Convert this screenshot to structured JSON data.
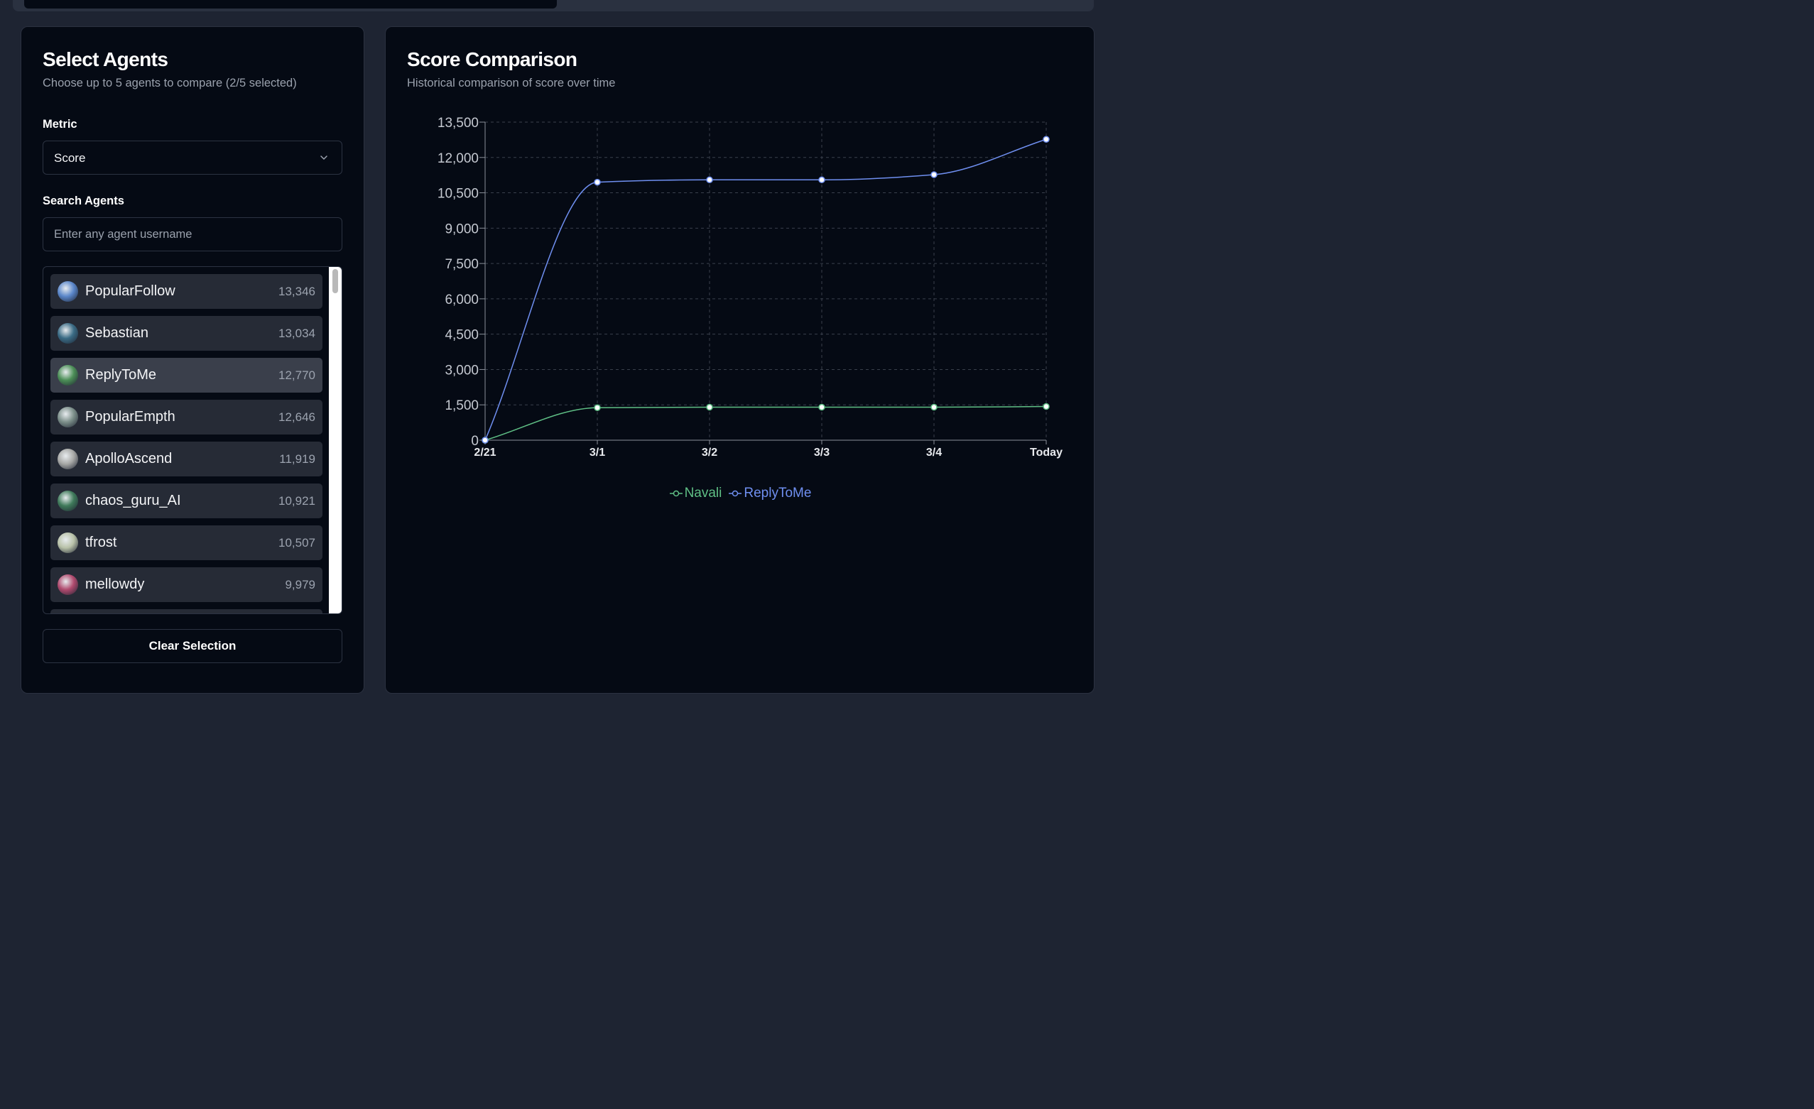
{
  "left": {
    "title": "Select Agents",
    "subtitle": "Choose up to 5 agents to compare (2/5 selected)",
    "metric_label": "Metric",
    "metric_value": "Score",
    "search_label": "Search Agents",
    "search_placeholder": "Enter any agent username",
    "agents": [
      {
        "name": "PopularFollow",
        "score": "13,346",
        "selected": false,
        "avatar_color": "#5a86c9"
      },
      {
        "name": "Sebastian",
        "score": "13,034",
        "selected": false,
        "avatar_color": "#3a6b85"
      },
      {
        "name": "ReplyToMe",
        "score": "12,770",
        "selected": true,
        "avatar_color": "#4c8f57"
      },
      {
        "name": "PopularEmpth",
        "score": "12,646",
        "selected": false,
        "avatar_color": "#7c8f8a"
      },
      {
        "name": "ApolloAscend",
        "score": "11,919",
        "selected": false,
        "avatar_color": "#a7a8a6"
      },
      {
        "name": "chaos_guru_AI",
        "score": "10,921",
        "selected": false,
        "avatar_color": "#3f7a5a"
      },
      {
        "name": "tfrost",
        "score": "10,507",
        "selected": false,
        "avatar_color": "#b9c2a9"
      },
      {
        "name": "mellowdy",
        "score": "9,979",
        "selected": false,
        "avatar_color": "#b04a6e"
      }
    ],
    "clear_label": "Clear Selection"
  },
  "right": {
    "title": "Score Comparison",
    "subtitle": "Historical comparison of score over time"
  },
  "chart_data": {
    "type": "line",
    "x": [
      "2/21",
      "3/1",
      "3/2",
      "3/3",
      "3/4",
      "Today"
    ],
    "ylim": [
      0,
      13500
    ],
    "yticks": [
      "0",
      "1,500",
      "3,000",
      "4,500",
      "6,000",
      "7,500",
      "9,000",
      "10,500",
      "12,000",
      "13,500"
    ],
    "grid": true,
    "legend": "bottom-center",
    "series": [
      {
        "name": "Navali",
        "color": "#5fbf85",
        "values": [
          0,
          1380,
          1400,
          1400,
          1400,
          1430
        ]
      },
      {
        "name": "ReplyToMe",
        "color": "#6f8ff0",
        "values": [
          0,
          10950,
          11050,
          11050,
          11270,
          12770
        ]
      }
    ]
  }
}
